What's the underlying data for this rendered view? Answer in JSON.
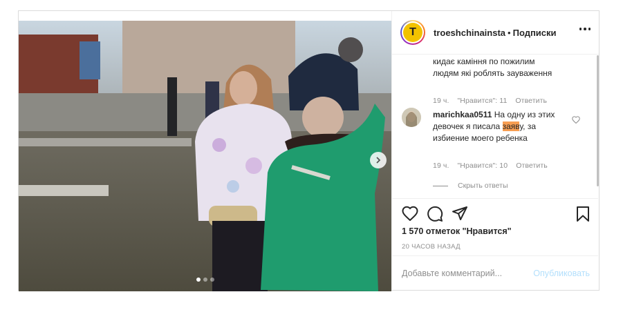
{
  "header": {
    "username": "troeshchinainsta",
    "separator": "•",
    "follow_label": "Подписки",
    "avatar_letter": "T"
  },
  "comments": [
    {
      "text_line1": "кидає каміння по пожилим",
      "text_line2": "людям які роблять зауваження",
      "age": "19 ч.",
      "likes": "\"Нравится\": 11",
      "reply": "Ответить"
    },
    {
      "user": "marichkaa0511",
      "text_part1": "На одну из этих",
      "text_line2_before": "девочек я писала ",
      "text_highlight": "заяв",
      "text_line2_after": "у, за",
      "text_line3": "избиение моего ребенка",
      "age": "19 ч.",
      "likes": "\"Нравится\": 10",
      "reply": "Ответить"
    }
  ],
  "hide_replies": "Скрыть ответы",
  "likes_count": "1 570 отметок \"Нравится\"",
  "post_time": "20 ЧАСОВ НАЗАД",
  "add_comment": {
    "placeholder": "Добавьте комментарий...",
    "publish_label": "Опубликовать"
  },
  "carousel": {
    "slides": 3,
    "active": 0
  },
  "colors": {
    "highlight": "#f79e52",
    "publish_disabled": "#b2dffc",
    "meta": "#8e8e8e"
  }
}
